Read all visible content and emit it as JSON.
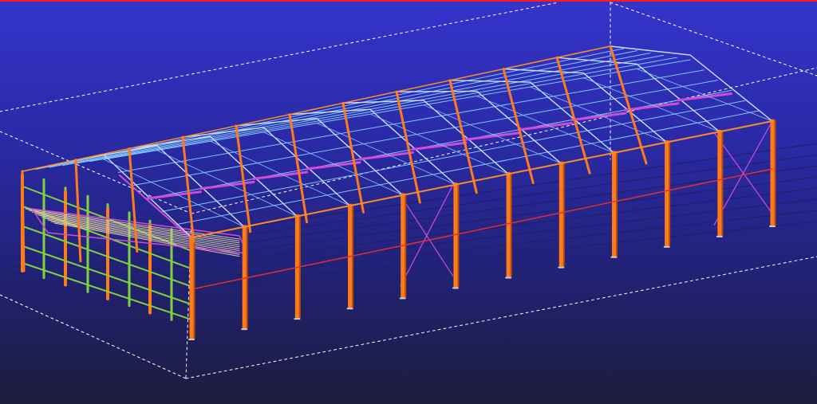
{
  "viewport": {
    "background_top": "#3434cc",
    "background_bottom": "#1c1c3c",
    "selection_bar_color": "#ff1a1a"
  },
  "colors": {
    "column": "#ff7a1a",
    "column_shadow": "#b84e08",
    "rafter": "#c8e0ff",
    "purlin": "#7fc6ff",
    "bracing": "#d24bd8",
    "eave_beam": "#ff8a2a",
    "tie_beam": "#e03030",
    "wall_frame": "#7fd33a",
    "mezzanine": "#d8c8a0",
    "work_area_box": "#ffffff",
    "grid_line": "#1f1f66"
  },
  "model": {
    "type": "steel portal frame building",
    "visible_frames": 12,
    "work_area_box": "dashed"
  }
}
